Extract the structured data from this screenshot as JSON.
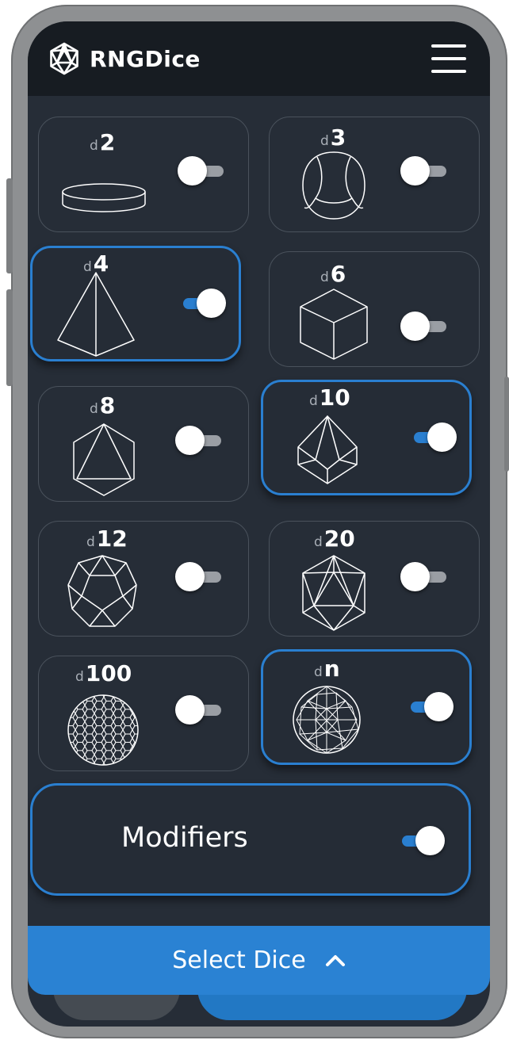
{
  "app": {
    "brand": "RNGDice"
  },
  "dice": [
    {
      "prefix": "d",
      "value": "2",
      "enabled": false,
      "icon": "coin-icon"
    },
    {
      "prefix": "d",
      "value": "3",
      "enabled": false,
      "icon": "d3-icon"
    },
    {
      "prefix": "d",
      "value": "4",
      "enabled": true,
      "icon": "tetrahedron-icon"
    },
    {
      "prefix": "d",
      "value": "6",
      "enabled": false,
      "icon": "cube-icon"
    },
    {
      "prefix": "d",
      "value": "8",
      "enabled": false,
      "icon": "octahedron-icon"
    },
    {
      "prefix": "d",
      "value": "10",
      "enabled": true,
      "icon": "d10-icon"
    },
    {
      "prefix": "d",
      "value": "12",
      "enabled": false,
      "icon": "dodecahedron-icon"
    },
    {
      "prefix": "d",
      "value": "20",
      "enabled": false,
      "icon": "icosahedron-icon"
    },
    {
      "prefix": "d",
      "value": "100",
      "enabled": false,
      "icon": "d100-sphere-icon"
    },
    {
      "prefix": "d",
      "value": "n",
      "enabled": true,
      "icon": "dn-sphere-icon"
    }
  ],
  "modifiers": {
    "label": "Modifiers",
    "enabled": true
  },
  "footer": {
    "select_label": "Select Dice",
    "chevron": "chevron-up-icon"
  },
  "colors": {
    "accent": "#2a7fd0",
    "background": "#262d37",
    "header": "#171c22"
  }
}
